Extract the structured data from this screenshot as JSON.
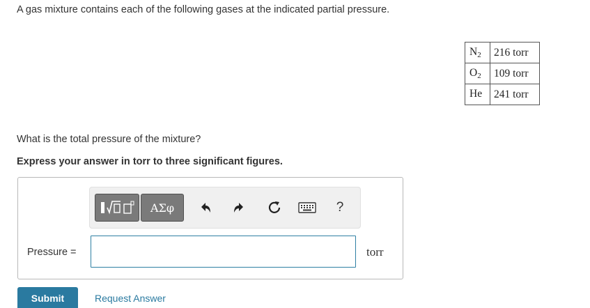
{
  "problem": {
    "intro": "A gas mixture contains each of the following gases at the indicated partial pressure.",
    "question": "What is the total pressure of the mixture?",
    "instruction": "Express your answer in torr to three significant figures."
  },
  "gas_table": {
    "rows": [
      {
        "symbol": "N",
        "subscript": "2",
        "value": "216 torr"
      },
      {
        "symbol": "O",
        "subscript": "2",
        "value": "109 torr"
      },
      {
        "symbol": "He",
        "subscript": "",
        "value": "241 torr"
      }
    ]
  },
  "toolbar": {
    "greek_label": "ΑΣφ",
    "help_label": "?",
    "icons": [
      "templates-icon",
      "undo-icon",
      "redo-icon",
      "reset-icon",
      "keyboard-icon",
      "help-icon"
    ]
  },
  "answer": {
    "label": "Pressure =",
    "value": "",
    "placeholder": "",
    "unit": "torr"
  },
  "actions": {
    "submit_label": "Submit",
    "request_label": "Request Answer"
  },
  "colors": {
    "accent": "#2a7aa0",
    "toolbar_button": "#7a7a7a",
    "toolbar_bg": "#f0f0f0"
  }
}
